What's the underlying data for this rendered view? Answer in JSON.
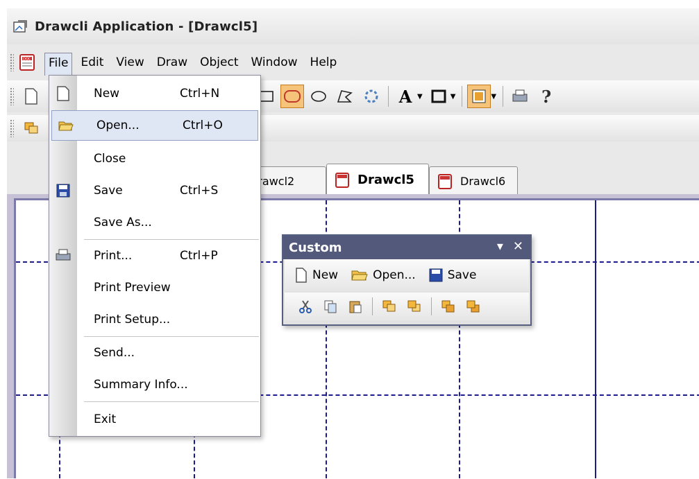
{
  "window": {
    "title": "Drawcli Application - [Drawcl5]"
  },
  "menubar": {
    "items": [
      "File",
      "Edit",
      "View",
      "Draw",
      "Object",
      "Window",
      "Help"
    ]
  },
  "file_menu": {
    "items": [
      {
        "label": "New",
        "shortcut": "Ctrl+N",
        "icon": "new-document-icon"
      },
      {
        "label": "Open...",
        "shortcut": "Ctrl+O",
        "icon": "open-folder-icon",
        "highlighted": true
      },
      {
        "label": "Close",
        "shortcut": ""
      },
      {
        "label": "Save",
        "shortcut": "Ctrl+S",
        "icon": "save-disk-icon"
      },
      {
        "label": "Save As...",
        "shortcut": ""
      },
      {
        "label": "Print...",
        "shortcut": "Ctrl+P",
        "icon": "printer-icon"
      },
      {
        "label": "Print Preview",
        "shortcut": ""
      },
      {
        "label": "Print Setup...",
        "shortcut": ""
      },
      {
        "label": "Send...",
        "shortcut": ""
      },
      {
        "label": "Summary Info...",
        "shortcut": ""
      },
      {
        "label": "Exit",
        "shortcut": ""
      }
    ]
  },
  "tabs": [
    {
      "label": "Drawcl2"
    },
    {
      "label": "Drawcl5",
      "active": true
    },
    {
      "label": "Drawcl6"
    }
  ],
  "custom_toolbar": {
    "title": "Custom",
    "new_label": "New",
    "open_label": "Open...",
    "save_label": "Save"
  },
  "colors": {
    "menu_highlight": "#dfe6f4",
    "active_tool": "#f6c37a",
    "float_title": "#52597b",
    "grid_line": "#1b1b8a"
  }
}
